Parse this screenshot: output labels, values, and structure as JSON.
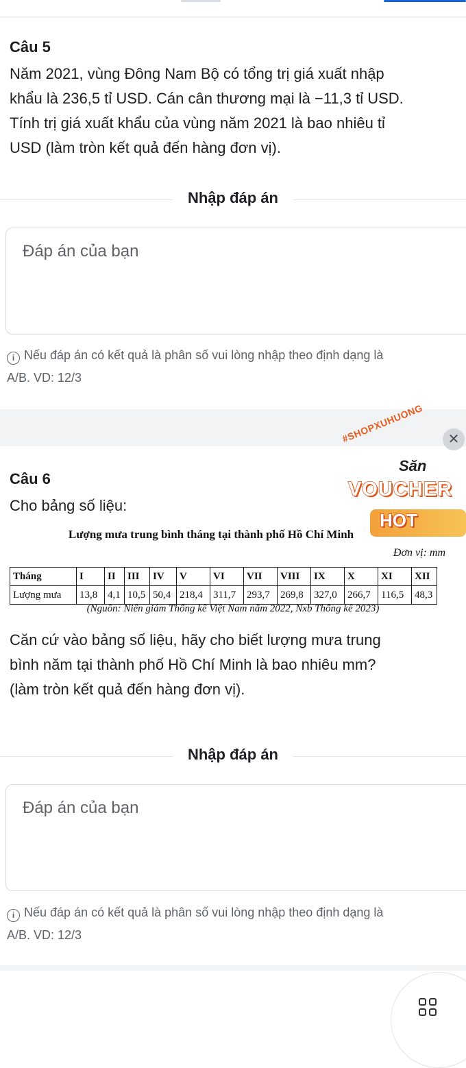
{
  "q5": {
    "title": "Câu 5",
    "lines": [
      "Năm 2021, vùng Đông Nam Bộ có tổng trị giá xuất nhập",
      "khẩu là 236,5 tỉ USD. Cán cân thương mại là −11,3 tỉ USD.",
      "Tính trị giá xuất khẩu của vùng năm 2021 là bao nhiêu tỉ",
      "USD (làm tròn kết quả đến hàng đơn vị)."
    ],
    "input_heading": "Nhập đáp án",
    "placeholder": "Đáp án của bạn",
    "hint_line1": "Nếu đáp án có kết quả là phân số vui lòng nhập theo định dạng là",
    "hint_line2": "A/B. VD: 12/3"
  },
  "q6": {
    "title": "Câu 6",
    "intro": "Cho bảng số liệu:",
    "table_title": "Lượng mưa trung bình tháng tại thành phố Hồ Chí Minh",
    "unit": "Đơn vị: mm",
    "table": {
      "headers": [
        "Tháng",
        "I",
        "II",
        "III",
        "IV",
        "V",
        "VI",
        "VII",
        "VIII",
        "IX",
        "X",
        "XI",
        "XII"
      ],
      "row_label": "Lượng mưa",
      "values": [
        "13,8",
        "4,1",
        "10,5",
        "50,4",
        "218,4",
        "311,7",
        "293,7",
        "269,8",
        "327,0",
        "266,7",
        "116,5",
        "48,3"
      ]
    },
    "source": "(Nguồn: Niên giám Thống kê Việt Nam năm 2022, Nxb Thống kê 2023)",
    "lines": [
      "Căn cứ vào bảng số liệu, hãy cho biết lượng mưa trung",
      "bình năm tại thành phố Hồ Chí Minh là bao nhiêu mm?",
      "(làm tròn kết quả đến hàng đơn vị)."
    ],
    "input_heading": "Nhập đáp án",
    "placeholder": "Đáp án của bạn",
    "hint_line1": "Nếu đáp án có kết quả là phân số vui lòng nhập theo định dạng là",
    "hint_line2": "A/B. VD: 12/3"
  },
  "promo": {
    "hashtag": "#SHOPXUHUONG",
    "san": "Săn",
    "voucher": "VOUCHER",
    "hot": "HOT",
    "close_icon": "close-icon"
  },
  "fab": {
    "icon": "grid-icon"
  }
}
